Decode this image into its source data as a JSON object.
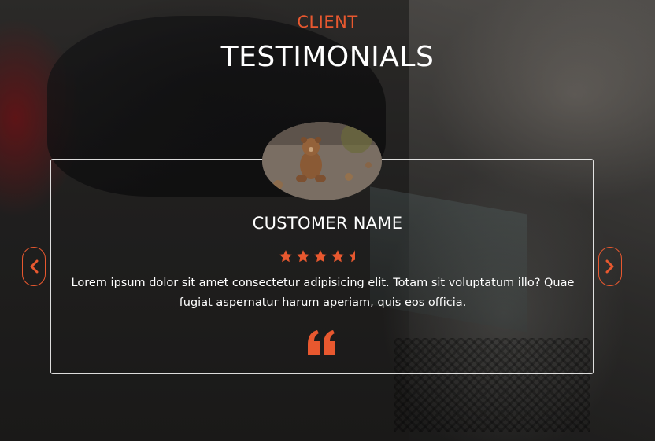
{
  "section": {
    "subtitle": "CLIENT",
    "title": "TESTIMONIALS"
  },
  "testimonial": {
    "customer_name": "CUSTOMER NAME",
    "rating": 4.5,
    "rating_max": 5,
    "text": "Lorem ipsum dolor sit amet consectetur adipisicing elit. Totam sit voluptatum illo? Quae fugiat aspernatur harum aperiam, quis eos officia.",
    "quote_icon": "quote-left-icon",
    "avatar": "teddy-bear-photo"
  },
  "navigation": {
    "prev_icon": "chevron-left-icon",
    "next_icon": "chevron-right-icon"
  },
  "colors": {
    "accent": "#e8582f",
    "text": "#ffffff",
    "card_border": "#ffffff"
  }
}
